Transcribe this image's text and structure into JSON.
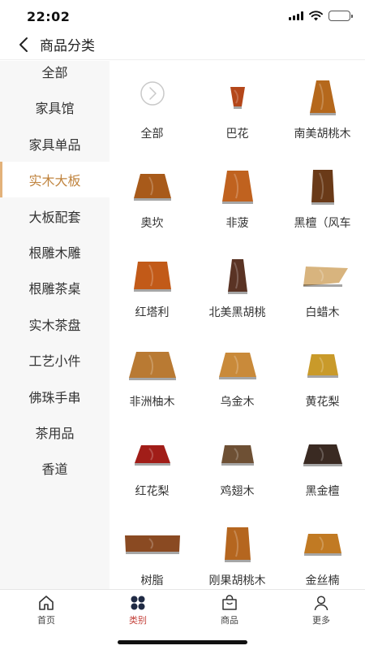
{
  "status_bar": {
    "time": "22:02"
  },
  "header": {
    "title": "商品分类"
  },
  "sidebar": {
    "items": [
      {
        "label": "全部"
      },
      {
        "label": "家具馆"
      },
      {
        "label": "家具单品"
      },
      {
        "label": "实木大板"
      },
      {
        "label": "大板配套"
      },
      {
        "label": "根雕木雕"
      },
      {
        "label": "根雕茶桌"
      },
      {
        "label": "实木茶盘"
      },
      {
        "label": "工艺小件"
      },
      {
        "label": "佛珠手串"
      },
      {
        "label": "茶用品"
      },
      {
        "label": "香道"
      }
    ],
    "active": "实木大板"
  },
  "grid": {
    "items": [
      {
        "label": "全部",
        "icon": "chevron-circle-icon"
      },
      {
        "label": "巴花",
        "icon": "wood-slab-icon",
        "color": "#b4471a"
      },
      {
        "label": "南美胡桃木",
        "icon": "wood-slab-icon",
        "color": "#b5681c"
      },
      {
        "label": "奥坎",
        "icon": "wood-slab-icon",
        "color": "#a85a1a"
      },
      {
        "label": "非菠",
        "icon": "wood-slab-icon",
        "color": "#c0621f"
      },
      {
        "label": "黑檀（风车",
        "icon": "wood-slab-icon",
        "color": "#6a3a18"
      },
      {
        "label": "红塔利",
        "icon": "wood-slab-icon",
        "color": "#c25a18"
      },
      {
        "label": "北美黑胡桃",
        "icon": "wood-slab-icon",
        "color": "#5a3324"
      },
      {
        "label": "白蜡木",
        "icon": "wood-slab-icon",
        "color": "#d8b47e"
      },
      {
        "label": "非洲柚木",
        "icon": "wood-slab-icon",
        "color": "#b97a33"
      },
      {
        "label": "乌金木",
        "icon": "wood-slab-icon",
        "color": "#c98a3a"
      },
      {
        "label": "黄花梨",
        "icon": "wood-slab-icon",
        "color": "#c99a2a"
      },
      {
        "label": "红花梨",
        "icon": "wood-slab-icon",
        "color": "#a11d18"
      },
      {
        "label": "鸡翅木",
        "icon": "wood-slab-icon",
        "color": "#6e5034"
      },
      {
        "label": "黑金檀",
        "icon": "wood-slab-icon",
        "color": "#3a2a22"
      },
      {
        "label": "树脂",
        "icon": "wood-slab-icon",
        "color": "#8a4a22"
      },
      {
        "label": "刚果胡桃木",
        "icon": "wood-slab-icon",
        "color": "#b5661f"
      },
      {
        "label": "金丝楠",
        "icon": "wood-slab-icon",
        "color": "#c17a23"
      }
    ]
  },
  "tabbar": {
    "tabs": [
      {
        "label": "首页",
        "icon": "home-icon"
      },
      {
        "label": "类别",
        "icon": "category-icon"
      },
      {
        "label": "商品",
        "icon": "shopping-bag-icon"
      },
      {
        "label": "更多",
        "icon": "person-icon"
      }
    ],
    "active": "类别",
    "accent_color": "#c4423b"
  }
}
